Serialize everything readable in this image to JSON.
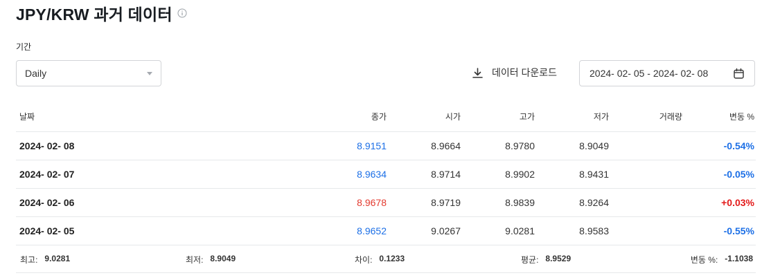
{
  "page": {
    "title": "JPY/KRW 과거 데이터",
    "info_icon": "info-circle-icon"
  },
  "filters": {
    "period_label": "기간",
    "frequency": "Daily",
    "download_label": "데이터 다운로드",
    "date_range": "2024- 02- 05 - 2024- 02- 08"
  },
  "table": {
    "headers": [
      "날짜",
      "종가",
      "시가",
      "고가",
      "저가",
      "거래량",
      "변동 %"
    ],
    "rows": [
      {
        "date": "2024- 02- 08",
        "close": "8.9151",
        "open": "8.9664",
        "high": "8.9780",
        "low": "8.9049",
        "volume": "",
        "change": "-0.54%",
        "dir": "down"
      },
      {
        "date": "2024- 02- 07",
        "close": "8.9634",
        "open": "8.9714",
        "high": "8.9902",
        "low": "8.9431",
        "volume": "",
        "change": "-0.05%",
        "dir": "down"
      },
      {
        "date": "2024- 02- 06",
        "close": "8.9678",
        "open": "8.9719",
        "high": "8.9839",
        "low": "8.9264",
        "volume": "",
        "change": "+0.03%",
        "dir": "up"
      },
      {
        "date": "2024- 02- 05",
        "close": "8.9652",
        "open": "9.0267",
        "high": "9.0281",
        "low": "8.9583",
        "volume": "",
        "change": "-0.55%",
        "dir": "down"
      }
    ]
  },
  "summary": {
    "high_label": "최고:",
    "high_value": "9.0281",
    "low_label": "최저:",
    "low_value": "8.9049",
    "diff_label": "차이:",
    "diff_value": "0.1233",
    "avg_label": "평균:",
    "avg_value": "8.9529",
    "change_label": "변동 %:",
    "change_value": "-1.1038"
  },
  "colors": {
    "down": "#1c6fe6",
    "up": "#e33a2f"
  }
}
